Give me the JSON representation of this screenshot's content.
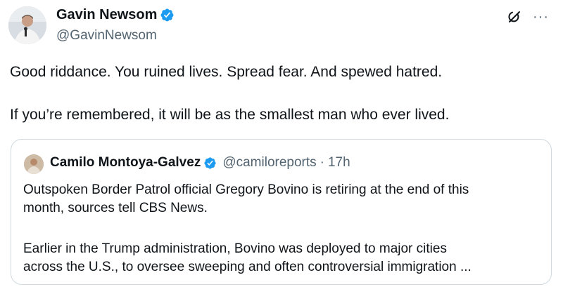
{
  "author": {
    "name": "Gavin Newsom",
    "handle": "@GavinNewsom"
  },
  "tweet": {
    "lines": [
      "Good riddance. You ruined lives. Spread fear. And spewed hatred.",
      "If you’re remembered, it will be as the smallest man who ever lived."
    ]
  },
  "quoted_tweet": {
    "name": "Camilo Montoya-Galvez",
    "handle": "@camiloreports",
    "separator": "·",
    "time": "17h",
    "lines": [
      "Outspoken Border Patrol official Gregory Bovino is retiring at the end of this",
      "month, sources tell CBS News.",
      "Earlier in the Trump administration, Bovino was deployed to major cities",
      "across the U.S., to oversee sweeping and often controversial immigration ..."
    ]
  },
  "icons": {
    "verified": "verified-badge-icon",
    "grok": "grok-icon",
    "more": "more-options-icon"
  },
  "more_glyph": "···",
  "colors": {
    "verified": "#1d9bf0",
    "text": "#0f1419",
    "secondary": "#536471",
    "border": "#cfd9de"
  }
}
